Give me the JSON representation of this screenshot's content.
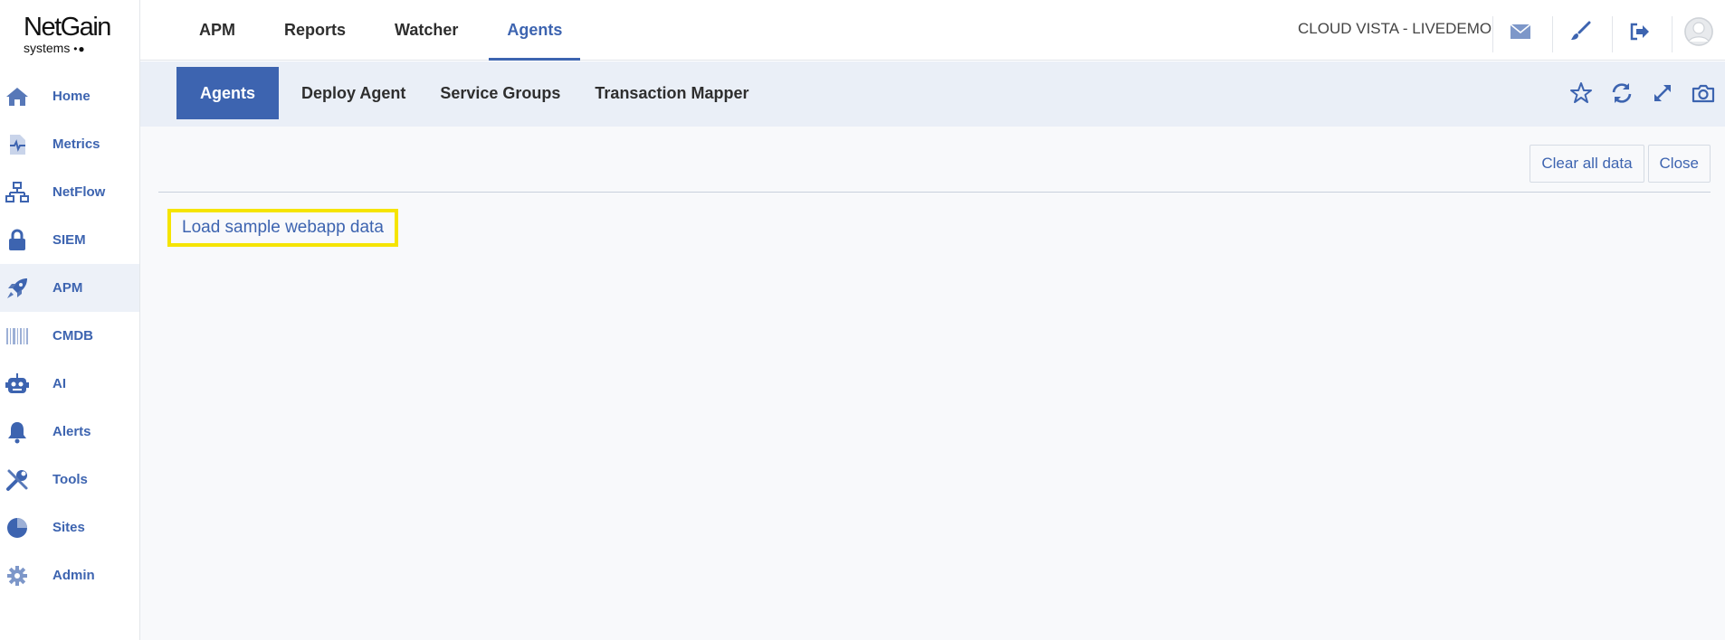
{
  "logo": {
    "name": "NetGain",
    "sub": "systems",
    "dots": "•●"
  },
  "sidebar": {
    "items": [
      {
        "label": "Home",
        "icon": "home-icon",
        "active": false
      },
      {
        "label": "Metrics",
        "icon": "metrics-icon",
        "active": false
      },
      {
        "label": "NetFlow",
        "icon": "netflow-icon",
        "active": false
      },
      {
        "label": "SIEM",
        "icon": "lock-icon",
        "active": false
      },
      {
        "label": "APM",
        "icon": "rocket-icon",
        "active": true
      },
      {
        "label": "CMDB",
        "icon": "barcode-icon",
        "active": false
      },
      {
        "label": "AI",
        "icon": "robot-icon",
        "active": false
      },
      {
        "label": "Alerts",
        "icon": "bell-icon",
        "active": false
      },
      {
        "label": "Tools",
        "icon": "tools-icon",
        "active": false
      },
      {
        "label": "Sites",
        "icon": "pie-icon",
        "active": false
      },
      {
        "label": "Admin",
        "icon": "gear-icon",
        "active": false
      }
    ]
  },
  "topnav": {
    "tabs": [
      {
        "label": "APM",
        "active": false
      },
      {
        "label": "Reports",
        "active": false
      },
      {
        "label": "Watcher",
        "active": false
      },
      {
        "label": "Agents",
        "active": true
      }
    ],
    "tenant": "CLOUD VISTA - LIVEDEMO",
    "icons": [
      "mail-icon",
      "brush-icon",
      "logout-icon",
      "avatar-icon"
    ]
  },
  "subnav": {
    "tabs": [
      {
        "label": "Agents",
        "active": true
      },
      {
        "label": "Deploy Agent",
        "active": false
      },
      {
        "label": "Service Groups",
        "active": false
      },
      {
        "label": "Transaction Mapper",
        "active": false
      }
    ],
    "icons": [
      "star-icon",
      "refresh-icon",
      "expand-icon",
      "camera-icon"
    ]
  },
  "content": {
    "clear_label": "Clear all data",
    "close_label": "Close",
    "sample_link": "Load sample webapp data"
  },
  "colors": {
    "accent": "#3d64b0",
    "highlight": "#f5e400",
    "subbar_bg": "#eaeff7",
    "content_bg": "#f8f9fb"
  }
}
